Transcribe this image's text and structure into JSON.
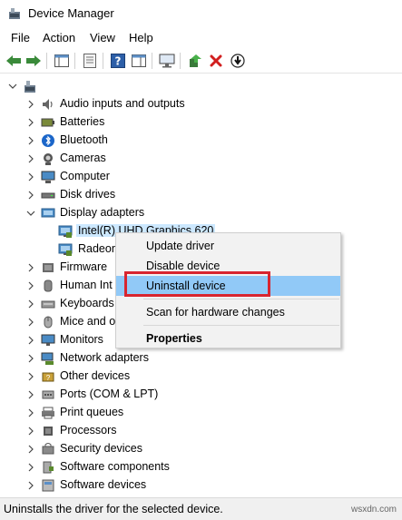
{
  "window": {
    "title": "Device Manager"
  },
  "menu": [
    "File",
    "Action",
    "View",
    "Help"
  ],
  "tree": {
    "root_label": "",
    "categories": [
      {
        "label": "Audio inputs and outputs",
        "icon": "speaker-icon"
      },
      {
        "label": "Batteries",
        "icon": "battery-icon"
      },
      {
        "label": "Bluetooth",
        "icon": "bluetooth-icon"
      },
      {
        "label": "Cameras",
        "icon": "camera-icon"
      },
      {
        "label": "Computer",
        "icon": "computer-icon"
      },
      {
        "label": "Disk drives",
        "icon": "disk-drive-icon"
      },
      {
        "label": "Display adapters",
        "icon": "display-adapter-icon",
        "expanded": true
      },
      {
        "label": "Firmware",
        "icon": "firmware-icon"
      },
      {
        "label": "Human Int",
        "icon": "hid-icon"
      },
      {
        "label": "Keyboards",
        "icon": "keyboard-icon"
      },
      {
        "label": "Mice and o",
        "icon": "mouse-icon"
      },
      {
        "label": "Monitors",
        "icon": "monitor-icon"
      },
      {
        "label": "Network adapters",
        "icon": "network-adapter-icon"
      },
      {
        "label": "Other devices",
        "icon": "other-devices-icon"
      },
      {
        "label": "Ports (COM & LPT)",
        "icon": "port-icon"
      },
      {
        "label": "Print queues",
        "icon": "printer-icon"
      },
      {
        "label": "Processors",
        "icon": "processor-icon"
      },
      {
        "label": "Security devices",
        "icon": "security-device-icon"
      },
      {
        "label": "Software components",
        "icon": "software-component-icon"
      },
      {
        "label": "Software devices",
        "icon": "software-device-icon"
      }
    ],
    "display_children": [
      "Intel(R) UHD Graphics 620",
      "Radeon"
    ]
  },
  "context_menu": {
    "items": [
      "Update driver",
      "Disable device",
      "Uninstall device",
      "Scan for hardware changes",
      "Properties"
    ],
    "hovered_index": 2
  },
  "status": {
    "text": "Uninstalls the driver for the selected device."
  },
  "watermark": "wsxdn.com",
  "colors": {
    "selection": "#cce8ff",
    "menu_hover": "#91c9f7",
    "highlight_box": "#d8252f"
  }
}
